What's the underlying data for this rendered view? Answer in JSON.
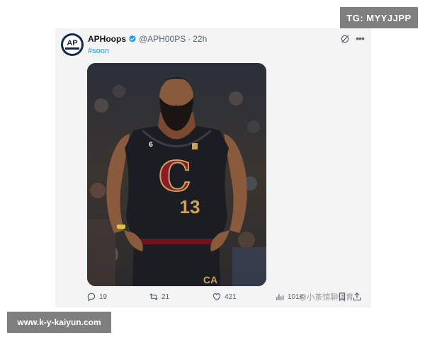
{
  "tweet": {
    "display_name": "APHoops",
    "handle": "@APH00PS",
    "separator": "·",
    "time": "22h",
    "hashtag": "#soon",
    "avatar_text": "AP",
    "verified_color": "#1d9bf0",
    "media_jersey": {
      "team_word": "C",
      "number": "13",
      "patch_number": "6",
      "trunks_text": "CA"
    }
  },
  "actions": {
    "replies": "19",
    "reposts": "21",
    "likes": "421",
    "views": "101K"
  },
  "watermarks": {
    "top": "TG: MYYJJPP",
    "bottom": "www.k-y-kaiyun.com",
    "platform_mark": "@小茶馆聊体育"
  },
  "icons": [
    "verified-icon",
    "grok-icon",
    "more-icon",
    "reply-icon",
    "repost-icon",
    "like-icon",
    "views-icon",
    "bookmark-icon",
    "share-icon"
  ],
  "colors": {
    "accent": "#1d9bf0",
    "card_bg": "#f4f4f4",
    "text": "#0f1419",
    "muted": "#536471"
  }
}
